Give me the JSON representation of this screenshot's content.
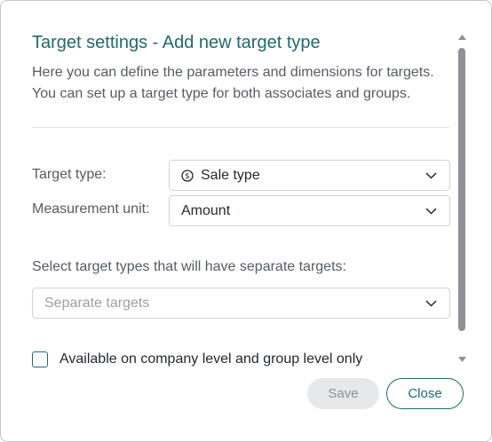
{
  "dialog": {
    "title": "Target settings - Add new target type",
    "description": "Here you can define the parameters and dimensions for targets. You can set up a target type for both associates and groups."
  },
  "form": {
    "target_type": {
      "label": "Target type:",
      "value": "Sale type",
      "icon": "coin-icon"
    },
    "measurement_unit": {
      "label": "Measurement unit:",
      "value": "Amount"
    },
    "separate_targets": {
      "label": "Select target types that will have separate targets:",
      "placeholder": "Separate targets"
    },
    "company_group_only": {
      "label": "Available on company level and group level only",
      "checked": false
    }
  },
  "buttons": {
    "save": "Save",
    "close": "Close"
  },
  "colors": {
    "accent": "#1f6a6e",
    "text": "#555c63",
    "disabled_bg": "#e6e8ea",
    "scrollbar": "#8e9296"
  }
}
